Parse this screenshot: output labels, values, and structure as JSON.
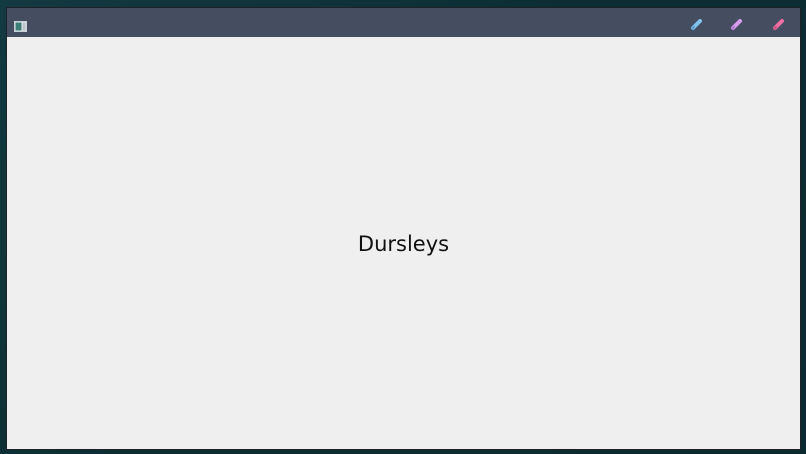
{
  "window": {
    "app_icon": "window-app-icon",
    "controls": {
      "minimize": {
        "icon": "pencil-icon",
        "color": "#7ec4ef"
      },
      "maximize": {
        "icon": "pencil-icon",
        "color": "#d79cf0"
      },
      "close": {
        "icon": "pencil-icon",
        "color": "#ef6fa3"
      }
    },
    "titlebar_color": "#454d60",
    "background_color": "#efefef"
  },
  "content": {
    "label": "Dursleys"
  }
}
